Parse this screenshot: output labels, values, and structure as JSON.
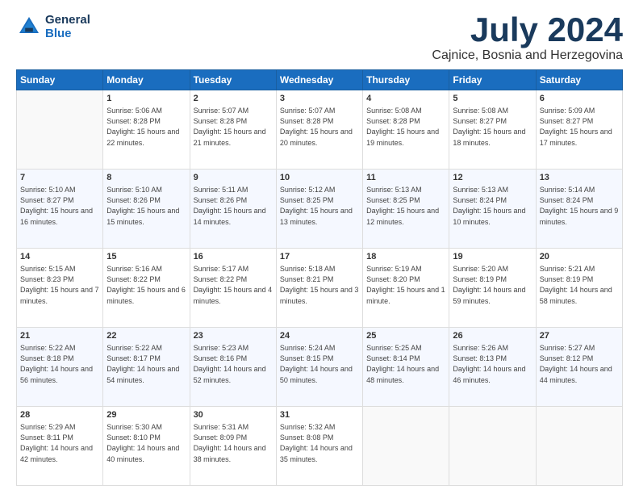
{
  "logo": {
    "line1": "General",
    "line2": "Blue"
  },
  "title": "July 2024",
  "subtitle": "Cajnice, Bosnia and Herzegovina",
  "days_of_week": [
    "Sunday",
    "Monday",
    "Tuesday",
    "Wednesday",
    "Thursday",
    "Friday",
    "Saturday"
  ],
  "weeks": [
    [
      {
        "day": "",
        "sunrise": "",
        "sunset": "",
        "daylight": ""
      },
      {
        "day": "1",
        "sunrise": "Sunrise: 5:06 AM",
        "sunset": "Sunset: 8:28 PM",
        "daylight": "Daylight: 15 hours and 22 minutes."
      },
      {
        "day": "2",
        "sunrise": "Sunrise: 5:07 AM",
        "sunset": "Sunset: 8:28 PM",
        "daylight": "Daylight: 15 hours and 21 minutes."
      },
      {
        "day": "3",
        "sunrise": "Sunrise: 5:07 AM",
        "sunset": "Sunset: 8:28 PM",
        "daylight": "Daylight: 15 hours and 20 minutes."
      },
      {
        "day": "4",
        "sunrise": "Sunrise: 5:08 AM",
        "sunset": "Sunset: 8:28 PM",
        "daylight": "Daylight: 15 hours and 19 minutes."
      },
      {
        "day": "5",
        "sunrise": "Sunrise: 5:08 AM",
        "sunset": "Sunset: 8:27 PM",
        "daylight": "Daylight: 15 hours and 18 minutes."
      },
      {
        "day": "6",
        "sunrise": "Sunrise: 5:09 AM",
        "sunset": "Sunset: 8:27 PM",
        "daylight": "Daylight: 15 hours and 17 minutes."
      }
    ],
    [
      {
        "day": "7",
        "sunrise": "Sunrise: 5:10 AM",
        "sunset": "Sunset: 8:27 PM",
        "daylight": "Daylight: 15 hours and 16 minutes."
      },
      {
        "day": "8",
        "sunrise": "Sunrise: 5:10 AM",
        "sunset": "Sunset: 8:26 PM",
        "daylight": "Daylight: 15 hours and 15 minutes."
      },
      {
        "day": "9",
        "sunrise": "Sunrise: 5:11 AM",
        "sunset": "Sunset: 8:26 PM",
        "daylight": "Daylight: 15 hours and 14 minutes."
      },
      {
        "day": "10",
        "sunrise": "Sunrise: 5:12 AM",
        "sunset": "Sunset: 8:25 PM",
        "daylight": "Daylight: 15 hours and 13 minutes."
      },
      {
        "day": "11",
        "sunrise": "Sunrise: 5:13 AM",
        "sunset": "Sunset: 8:25 PM",
        "daylight": "Daylight: 15 hours and 12 minutes."
      },
      {
        "day": "12",
        "sunrise": "Sunrise: 5:13 AM",
        "sunset": "Sunset: 8:24 PM",
        "daylight": "Daylight: 15 hours and 10 minutes."
      },
      {
        "day": "13",
        "sunrise": "Sunrise: 5:14 AM",
        "sunset": "Sunset: 8:24 PM",
        "daylight": "Daylight: 15 hours and 9 minutes."
      }
    ],
    [
      {
        "day": "14",
        "sunrise": "Sunrise: 5:15 AM",
        "sunset": "Sunset: 8:23 PM",
        "daylight": "Daylight: 15 hours and 7 minutes."
      },
      {
        "day": "15",
        "sunrise": "Sunrise: 5:16 AM",
        "sunset": "Sunset: 8:22 PM",
        "daylight": "Daylight: 15 hours and 6 minutes."
      },
      {
        "day": "16",
        "sunrise": "Sunrise: 5:17 AM",
        "sunset": "Sunset: 8:22 PM",
        "daylight": "Daylight: 15 hours and 4 minutes."
      },
      {
        "day": "17",
        "sunrise": "Sunrise: 5:18 AM",
        "sunset": "Sunset: 8:21 PM",
        "daylight": "Daylight: 15 hours and 3 minutes."
      },
      {
        "day": "18",
        "sunrise": "Sunrise: 5:19 AM",
        "sunset": "Sunset: 8:20 PM",
        "daylight": "Daylight: 15 hours and 1 minute."
      },
      {
        "day": "19",
        "sunrise": "Sunrise: 5:20 AM",
        "sunset": "Sunset: 8:19 PM",
        "daylight": "Daylight: 14 hours and 59 minutes."
      },
      {
        "day": "20",
        "sunrise": "Sunrise: 5:21 AM",
        "sunset": "Sunset: 8:19 PM",
        "daylight": "Daylight: 14 hours and 58 minutes."
      }
    ],
    [
      {
        "day": "21",
        "sunrise": "Sunrise: 5:22 AM",
        "sunset": "Sunset: 8:18 PM",
        "daylight": "Daylight: 14 hours and 56 minutes."
      },
      {
        "day": "22",
        "sunrise": "Sunrise: 5:22 AM",
        "sunset": "Sunset: 8:17 PM",
        "daylight": "Daylight: 14 hours and 54 minutes."
      },
      {
        "day": "23",
        "sunrise": "Sunrise: 5:23 AM",
        "sunset": "Sunset: 8:16 PM",
        "daylight": "Daylight: 14 hours and 52 minutes."
      },
      {
        "day": "24",
        "sunrise": "Sunrise: 5:24 AM",
        "sunset": "Sunset: 8:15 PM",
        "daylight": "Daylight: 14 hours and 50 minutes."
      },
      {
        "day": "25",
        "sunrise": "Sunrise: 5:25 AM",
        "sunset": "Sunset: 8:14 PM",
        "daylight": "Daylight: 14 hours and 48 minutes."
      },
      {
        "day": "26",
        "sunrise": "Sunrise: 5:26 AM",
        "sunset": "Sunset: 8:13 PM",
        "daylight": "Daylight: 14 hours and 46 minutes."
      },
      {
        "day": "27",
        "sunrise": "Sunrise: 5:27 AM",
        "sunset": "Sunset: 8:12 PM",
        "daylight": "Daylight: 14 hours and 44 minutes."
      }
    ],
    [
      {
        "day": "28",
        "sunrise": "Sunrise: 5:29 AM",
        "sunset": "Sunset: 8:11 PM",
        "daylight": "Daylight: 14 hours and 42 minutes."
      },
      {
        "day": "29",
        "sunrise": "Sunrise: 5:30 AM",
        "sunset": "Sunset: 8:10 PM",
        "daylight": "Daylight: 14 hours and 40 minutes."
      },
      {
        "day": "30",
        "sunrise": "Sunrise: 5:31 AM",
        "sunset": "Sunset: 8:09 PM",
        "daylight": "Daylight: 14 hours and 38 minutes."
      },
      {
        "day": "31",
        "sunrise": "Sunrise: 5:32 AM",
        "sunset": "Sunset: 8:08 PM",
        "daylight": "Daylight: 14 hours and 35 minutes."
      },
      {
        "day": "",
        "sunrise": "",
        "sunset": "",
        "daylight": ""
      },
      {
        "day": "",
        "sunrise": "",
        "sunset": "",
        "daylight": ""
      },
      {
        "day": "",
        "sunrise": "",
        "sunset": "",
        "daylight": ""
      }
    ]
  ]
}
